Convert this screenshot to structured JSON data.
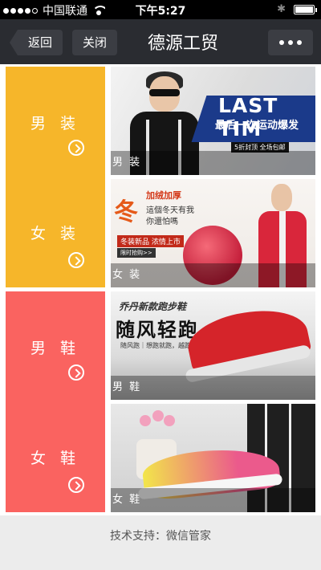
{
  "status_bar": {
    "carrier": "中国联通",
    "time": "下午5:27"
  },
  "nav": {
    "back_label": "返回",
    "close_label": "关闭",
    "title": "德源工贸",
    "more_icon": "ellipsis-icon"
  },
  "sections": [
    {
      "color": "#f6b62a",
      "items": [
        {
          "label": "男 装",
          "caption": "男 装"
        },
        {
          "label": "女 装",
          "caption": "女 装"
        }
      ]
    },
    {
      "color": "#fa6360",
      "items": [
        {
          "label": "男 鞋",
          "caption": "男 鞋"
        },
        {
          "label": "女 鞋",
          "caption": "女 鞋"
        }
      ]
    }
  ],
  "banners": {
    "men_clothing": {
      "headline": "LAST TIM",
      "subline": "最后一次运动爆发",
      "tag": "5折封顶 全场包邮"
    },
    "women_clothing": {
      "big": "冬",
      "line1": "加绒加厚",
      "line2": "這個冬天有我",
      "line3": "你還怕嗎",
      "tagline": "冬装新品 浓情上市",
      "button": "限时抢购>>"
    },
    "men_shoes": {
      "line1": "乔丹新款跑步鞋",
      "line2": "随风轻跑",
      "line3": "随风跑｜想跑就跑，越跑越快乐！"
    }
  },
  "footer": {
    "text": "技术支持：微信管家"
  }
}
